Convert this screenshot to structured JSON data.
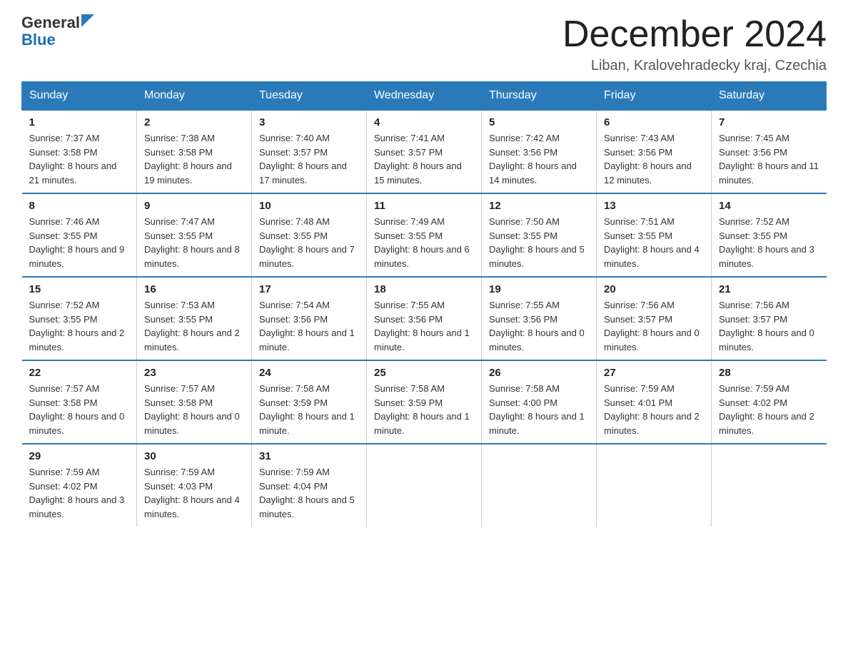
{
  "header": {
    "logo_general": "General",
    "logo_blue": "Blue",
    "month_title": "December 2024",
    "location": "Liban, Kralovehradecky kraj, Czechia"
  },
  "weekdays": [
    "Sunday",
    "Monday",
    "Tuesday",
    "Wednesday",
    "Thursday",
    "Friday",
    "Saturday"
  ],
  "weeks": [
    [
      {
        "day": "1",
        "sunrise": "7:37 AM",
        "sunset": "3:58 PM",
        "daylight": "8 hours and 21 minutes."
      },
      {
        "day": "2",
        "sunrise": "7:38 AM",
        "sunset": "3:58 PM",
        "daylight": "8 hours and 19 minutes."
      },
      {
        "day": "3",
        "sunrise": "7:40 AM",
        "sunset": "3:57 PM",
        "daylight": "8 hours and 17 minutes."
      },
      {
        "day": "4",
        "sunrise": "7:41 AM",
        "sunset": "3:57 PM",
        "daylight": "8 hours and 15 minutes."
      },
      {
        "day": "5",
        "sunrise": "7:42 AM",
        "sunset": "3:56 PM",
        "daylight": "8 hours and 14 minutes."
      },
      {
        "day": "6",
        "sunrise": "7:43 AM",
        "sunset": "3:56 PM",
        "daylight": "8 hours and 12 minutes."
      },
      {
        "day": "7",
        "sunrise": "7:45 AM",
        "sunset": "3:56 PM",
        "daylight": "8 hours and 11 minutes."
      }
    ],
    [
      {
        "day": "8",
        "sunrise": "7:46 AM",
        "sunset": "3:55 PM",
        "daylight": "8 hours and 9 minutes."
      },
      {
        "day": "9",
        "sunrise": "7:47 AM",
        "sunset": "3:55 PM",
        "daylight": "8 hours and 8 minutes."
      },
      {
        "day": "10",
        "sunrise": "7:48 AM",
        "sunset": "3:55 PM",
        "daylight": "8 hours and 7 minutes."
      },
      {
        "day": "11",
        "sunrise": "7:49 AM",
        "sunset": "3:55 PM",
        "daylight": "8 hours and 6 minutes."
      },
      {
        "day": "12",
        "sunrise": "7:50 AM",
        "sunset": "3:55 PM",
        "daylight": "8 hours and 5 minutes."
      },
      {
        "day": "13",
        "sunrise": "7:51 AM",
        "sunset": "3:55 PM",
        "daylight": "8 hours and 4 minutes."
      },
      {
        "day": "14",
        "sunrise": "7:52 AM",
        "sunset": "3:55 PM",
        "daylight": "8 hours and 3 minutes."
      }
    ],
    [
      {
        "day": "15",
        "sunrise": "7:52 AM",
        "sunset": "3:55 PM",
        "daylight": "8 hours and 2 minutes."
      },
      {
        "day": "16",
        "sunrise": "7:53 AM",
        "sunset": "3:55 PM",
        "daylight": "8 hours and 2 minutes."
      },
      {
        "day": "17",
        "sunrise": "7:54 AM",
        "sunset": "3:56 PM",
        "daylight": "8 hours and 1 minute."
      },
      {
        "day": "18",
        "sunrise": "7:55 AM",
        "sunset": "3:56 PM",
        "daylight": "8 hours and 1 minute."
      },
      {
        "day": "19",
        "sunrise": "7:55 AM",
        "sunset": "3:56 PM",
        "daylight": "8 hours and 0 minutes."
      },
      {
        "day": "20",
        "sunrise": "7:56 AM",
        "sunset": "3:57 PM",
        "daylight": "8 hours and 0 minutes."
      },
      {
        "day": "21",
        "sunrise": "7:56 AM",
        "sunset": "3:57 PM",
        "daylight": "8 hours and 0 minutes."
      }
    ],
    [
      {
        "day": "22",
        "sunrise": "7:57 AM",
        "sunset": "3:58 PM",
        "daylight": "8 hours and 0 minutes."
      },
      {
        "day": "23",
        "sunrise": "7:57 AM",
        "sunset": "3:58 PM",
        "daylight": "8 hours and 0 minutes."
      },
      {
        "day": "24",
        "sunrise": "7:58 AM",
        "sunset": "3:59 PM",
        "daylight": "8 hours and 1 minute."
      },
      {
        "day": "25",
        "sunrise": "7:58 AM",
        "sunset": "3:59 PM",
        "daylight": "8 hours and 1 minute."
      },
      {
        "day": "26",
        "sunrise": "7:58 AM",
        "sunset": "4:00 PM",
        "daylight": "8 hours and 1 minute."
      },
      {
        "day": "27",
        "sunrise": "7:59 AM",
        "sunset": "4:01 PM",
        "daylight": "8 hours and 2 minutes."
      },
      {
        "day": "28",
        "sunrise": "7:59 AM",
        "sunset": "4:02 PM",
        "daylight": "8 hours and 2 minutes."
      }
    ],
    [
      {
        "day": "29",
        "sunrise": "7:59 AM",
        "sunset": "4:02 PM",
        "daylight": "8 hours and 3 minutes."
      },
      {
        "day": "30",
        "sunrise": "7:59 AM",
        "sunset": "4:03 PM",
        "daylight": "8 hours and 4 minutes."
      },
      {
        "day": "31",
        "sunrise": "7:59 AM",
        "sunset": "4:04 PM",
        "daylight": "8 hours and 5 minutes."
      },
      null,
      null,
      null,
      null
    ]
  ]
}
